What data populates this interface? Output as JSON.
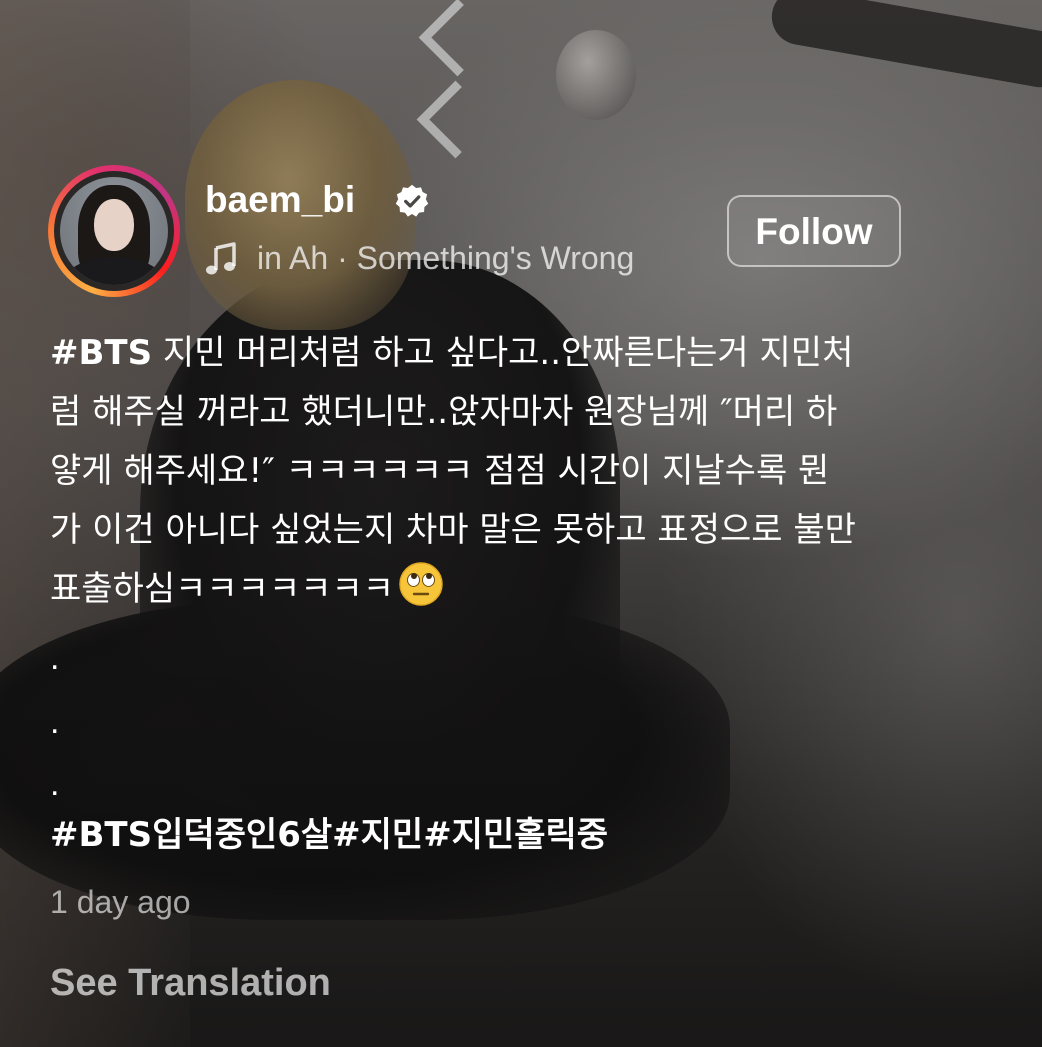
{
  "post": {
    "username": "baem_bi",
    "verified": true,
    "music": {
      "icon": "music-note-icon",
      "text": "in Ah · Something's Wrong"
    },
    "follow_label": "Follow",
    "caption": {
      "lines": [
        {
          "tag": "#BTS",
          "text": " 지민 머리처럼 하고 싶다고..안짜른다는거 지민처"
        },
        {
          "text": "럼 해주실 꺼라고 했더니만..앉자마자 원장님께 ″머리 하"
        },
        {
          "text": "얗게 해주세요!″ ㅋㅋㅋㅋㅋㅋ 점점 시간이 지날수록 뭔"
        },
        {
          "text": "가 이건 아니다 싶었는지 차마 말은 못하고 표정으로 불만"
        },
        {
          "text": "표출하심ㅋㅋㅋㅋㅋㅋㅋ"
        }
      ],
      "emoji": "face-with-rolling-eyes",
      "dots": [
        ".",
        ".",
        "."
      ],
      "hashtags": "#BTS입덕중인6살#지민#지민홀릭중"
    },
    "timestamp": "1 day ago",
    "see_translation": "See Translation"
  },
  "colors": {
    "ring_gradient": [
      "#fcaf45",
      "#f77737",
      "#e1306c",
      "#c13584"
    ],
    "verified_fill": "#ffffff",
    "text_primary": "#ffffff"
  }
}
